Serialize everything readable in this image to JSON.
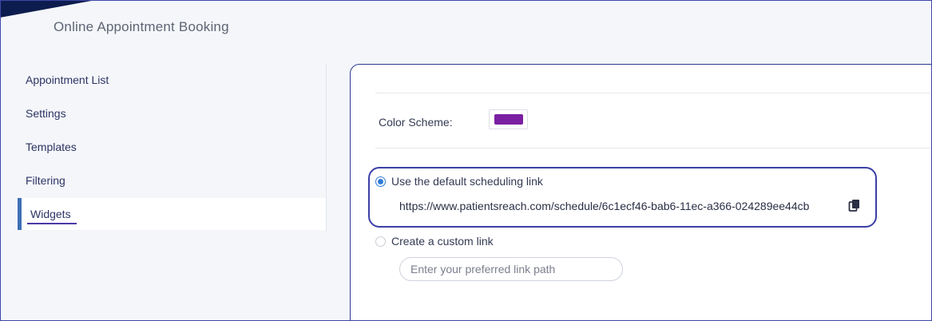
{
  "header": {
    "title": "Online Appointment Booking"
  },
  "sidebar": {
    "items": [
      {
        "label": "Appointment List"
      },
      {
        "label": "Settings"
      },
      {
        "label": "Templates"
      },
      {
        "label": "Filtering"
      },
      {
        "label": "Widgets"
      }
    ],
    "active_index": 4
  },
  "widget": {
    "color_scheme_label": "Color Scheme:",
    "color_scheme_value": "#7b1fa2",
    "default_link_label": "Use the default scheduling link",
    "default_link_url": "https://www.patientsreach.com/schedule/6c1ecf46-bab6-11ec-a366-024289ee44cb",
    "custom_link_label": "Create a custom link",
    "custom_link_placeholder": "Enter your preferred link path",
    "custom_link_value": "",
    "selected_option": "default"
  },
  "icons": {
    "copy": "copy-icon"
  },
  "colors": {
    "accent": "#3d6fb5",
    "highlight_border": "#3b3fa6",
    "radio_selected": "#2f7bd8",
    "header_corner": "#0d1c4e"
  }
}
